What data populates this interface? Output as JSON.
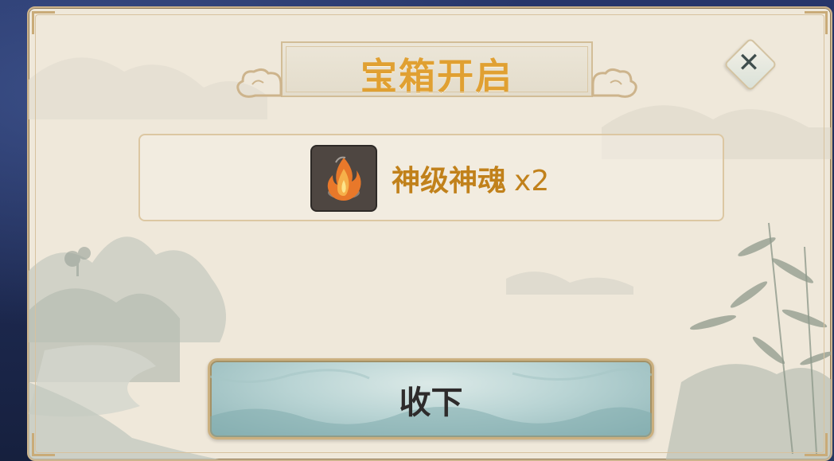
{
  "dialog": {
    "title": "宝箱开启",
    "close_icon": "close-icon"
  },
  "reward": {
    "item_icon": "soul-flame-icon",
    "item_name": "神级神魂",
    "item_count": "x2"
  },
  "actions": {
    "collect_label": "收下"
  },
  "colors": {
    "title": "#e0a032",
    "item_text": "#c1811b",
    "button_bg": "#b9d4d4",
    "frame": "#cdb48c"
  }
}
